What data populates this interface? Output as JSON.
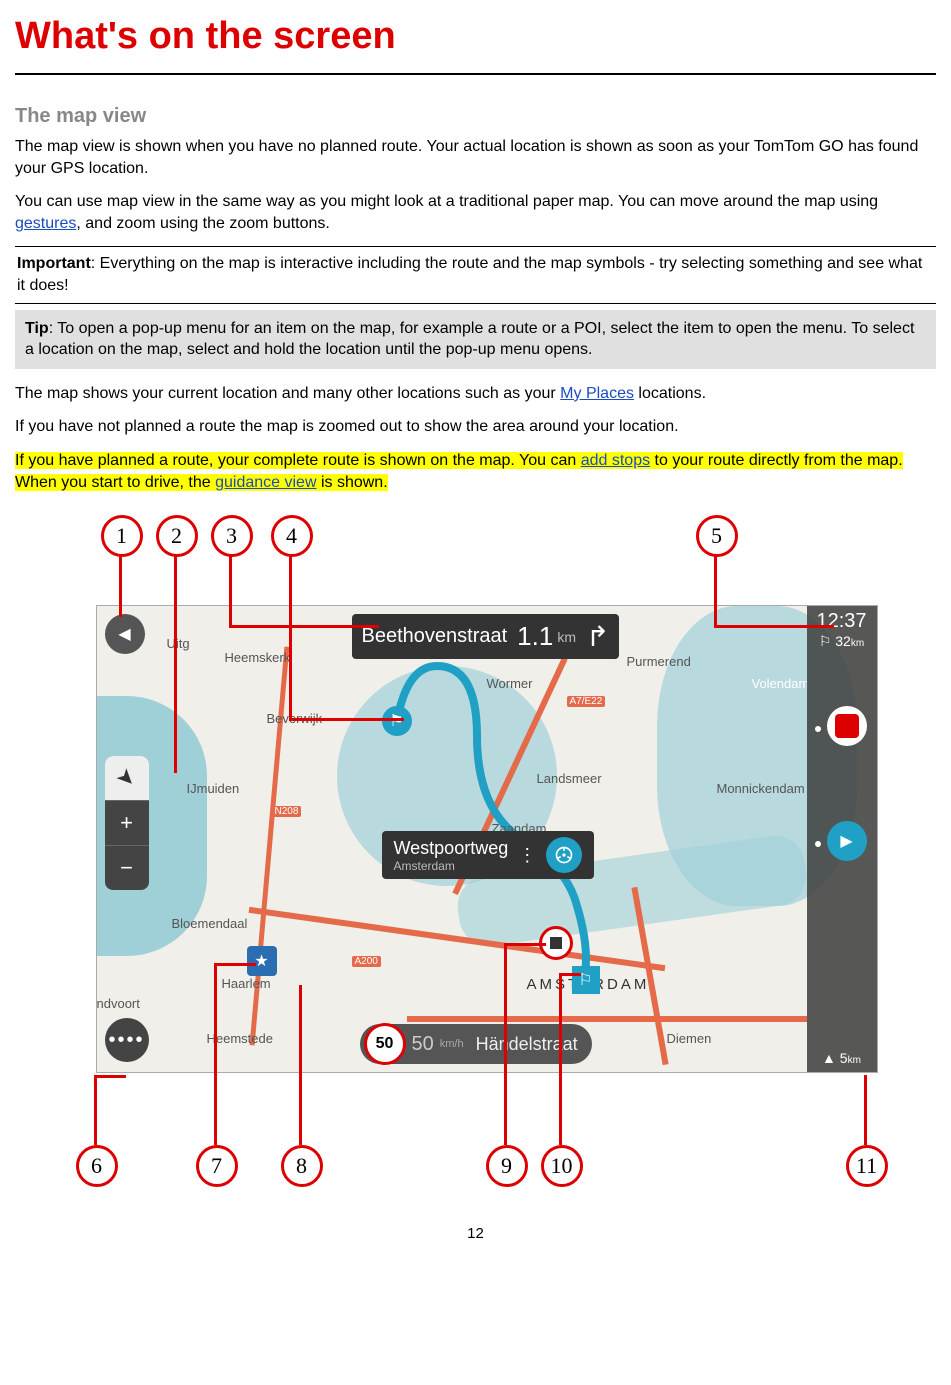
{
  "page": {
    "title": "What's on the screen",
    "section_heading": "The map view",
    "para1": "The map view is shown when you have no planned route. Your actual location is shown as soon as your TomTom GO has found your GPS location.",
    "para2_a": "You can use map view in the same way as you might look at a traditional paper map. You can move around the map using ",
    "para2_link": "gestures",
    "para2_b": ", and zoom using the zoom buttons.",
    "important_label": "Important",
    "important_text": ": Everything on the map is interactive including the route and the map symbols - try selecting something and see what it does!",
    "tip_label": "Tip",
    "tip_text": ": To open a pop-up menu for an item on the map, for example a route or a POI, select the item to open the menu. To select a location on the map, select and hold the location until the pop-up menu opens.",
    "para3_a": "The map shows your current location and many other locations such as your ",
    "para3_link": "My Places",
    "para3_b": " locations.",
    "para4": "If you have not planned a route the map is zoomed out to show the area around your location.",
    "para5_a": "If you have planned a route, your complete route is shown on the map. You can ",
    "para5_link1": "add stops",
    "para5_b": " to your route directly from the map. When you start to drive, the ",
    "para5_link2": "guidance view",
    "para5_c": " is shown.",
    "page_number": "12"
  },
  "callouts": {
    "c1": "1",
    "c2": "2",
    "c3": "3",
    "c4": "4",
    "c5": "5",
    "c6": "6",
    "c7": "7",
    "c8": "8",
    "c9": "9",
    "c10": "10",
    "c11": "11"
  },
  "map": {
    "instruction_street": "Beethovenstraat",
    "instruction_dist_value": "1.1",
    "instruction_dist_unit": "km",
    "popup_location": "Westpoortweg",
    "popup_sub": "Amsterdam",
    "speed_limit": "50",
    "current_speed_value": "50",
    "current_speed_unit": "km/h",
    "current_street": "Händelstraat",
    "routebar": {
      "arrival_time": "12:37",
      "remaining_dist_value": "32",
      "remaining_dist_unit": "km",
      "bottom_dist_value": "5",
      "bottom_dist_unit": "km"
    },
    "places": {
      "heemskerk": "Heemskerk",
      "beverwijk": "Beverwijk",
      "ijmuiden": "IJmuiden",
      "bloemendaal": "Bloemendaal",
      "haarlem": "Haarlem",
      "heemstede": "Heemstede",
      "ndvoort": "ndvoort",
      "wormer": "Wormer",
      "purmerend": "Purmerend",
      "zaandam": "Zaandam",
      "amsterdam": "AMSTERDAM",
      "diemen": "Diemen",
      "volendam": "Volendam",
      "monnickendam": "Monnickendam",
      "uitg": "Uitg",
      "landsmeer": "Landsmeer"
    },
    "road_labels": {
      "n208": "N208",
      "a200": "A200",
      "a7e22": "A7/E22"
    }
  }
}
